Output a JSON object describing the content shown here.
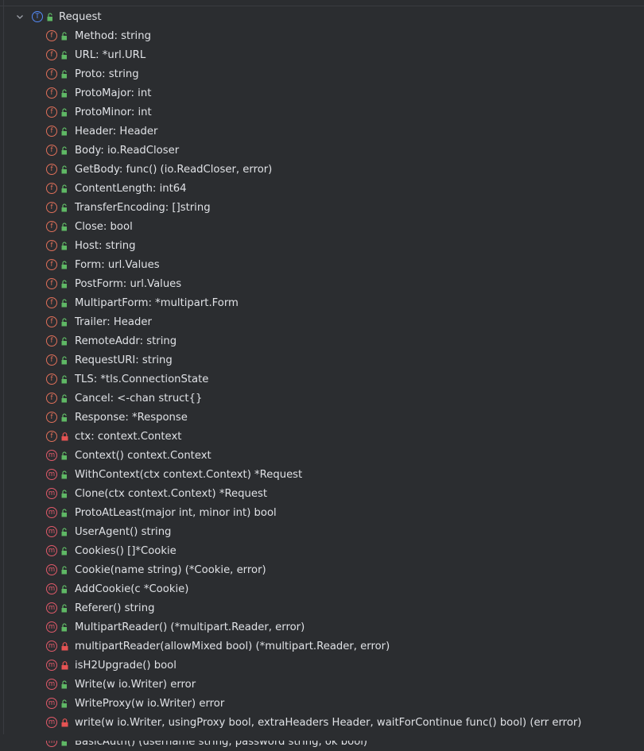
{
  "tree": {
    "root": {
      "label": "Request",
      "kind_letter": "T",
      "expanded": true,
      "visibility": "public"
    },
    "items": [
      {
        "kind": "f",
        "vis": "public",
        "label": "Method: string"
      },
      {
        "kind": "f",
        "vis": "public",
        "label": "URL: *url.URL"
      },
      {
        "kind": "f",
        "vis": "public",
        "label": "Proto: string"
      },
      {
        "kind": "f",
        "vis": "public",
        "label": "ProtoMajor: int"
      },
      {
        "kind": "f",
        "vis": "public",
        "label": "ProtoMinor: int"
      },
      {
        "kind": "f",
        "vis": "public",
        "label": "Header: Header"
      },
      {
        "kind": "f",
        "vis": "public",
        "label": "Body: io.ReadCloser"
      },
      {
        "kind": "f",
        "vis": "public",
        "label": "GetBody: func() (io.ReadCloser, error)"
      },
      {
        "kind": "f",
        "vis": "public",
        "label": "ContentLength: int64"
      },
      {
        "kind": "f",
        "vis": "public",
        "label": "TransferEncoding: []string"
      },
      {
        "kind": "f",
        "vis": "public",
        "label": "Close: bool"
      },
      {
        "kind": "f",
        "vis": "public",
        "label": "Host: string"
      },
      {
        "kind": "f",
        "vis": "public",
        "label": "Form: url.Values"
      },
      {
        "kind": "f",
        "vis": "public",
        "label": "PostForm: url.Values"
      },
      {
        "kind": "f",
        "vis": "public",
        "label": "MultipartForm: *multipart.Form"
      },
      {
        "kind": "f",
        "vis": "public",
        "label": "Trailer: Header"
      },
      {
        "kind": "f",
        "vis": "public",
        "label": "RemoteAddr: string"
      },
      {
        "kind": "f",
        "vis": "public",
        "label": "RequestURI: string"
      },
      {
        "kind": "f",
        "vis": "public",
        "label": "TLS: *tls.ConnectionState"
      },
      {
        "kind": "f",
        "vis": "public",
        "label": "Cancel: <-chan struct{}"
      },
      {
        "kind": "f",
        "vis": "public",
        "label": "Response: *Response"
      },
      {
        "kind": "f",
        "vis": "private",
        "label": "ctx: context.Context"
      },
      {
        "kind": "m",
        "vis": "public",
        "label": "Context() context.Context"
      },
      {
        "kind": "m",
        "vis": "public",
        "label": "WithContext(ctx context.Context) *Request"
      },
      {
        "kind": "m",
        "vis": "public",
        "label": "Clone(ctx context.Context) *Request"
      },
      {
        "kind": "m",
        "vis": "public",
        "label": "ProtoAtLeast(major int, minor int) bool"
      },
      {
        "kind": "m",
        "vis": "public",
        "label": "UserAgent() string"
      },
      {
        "kind": "m",
        "vis": "public",
        "label": "Cookies() []*Cookie"
      },
      {
        "kind": "m",
        "vis": "public",
        "label": "Cookie(name string) (*Cookie, error)"
      },
      {
        "kind": "m",
        "vis": "public",
        "label": "AddCookie(c *Cookie)"
      },
      {
        "kind": "m",
        "vis": "public",
        "label": "Referer() string"
      },
      {
        "kind": "m",
        "vis": "public",
        "label": "MultipartReader() (*multipart.Reader, error)"
      },
      {
        "kind": "m",
        "vis": "private",
        "label": "multipartReader(allowMixed bool) (*multipart.Reader, error)"
      },
      {
        "kind": "m",
        "vis": "private",
        "label": "isH2Upgrade() bool"
      },
      {
        "kind": "m",
        "vis": "public",
        "label": "Write(w io.Writer) error"
      },
      {
        "kind": "m",
        "vis": "public",
        "label": "WriteProxy(w io.Writer) error"
      },
      {
        "kind": "m",
        "vis": "private",
        "label": "write(w io.Writer, usingProxy bool, extraHeaders Header, waitForContinue func() bool) (err error)"
      },
      {
        "kind": "m",
        "vis": "public",
        "label": "BasicAuth() (username string, password string, ok bool)"
      }
    ]
  },
  "colors": {
    "background": "#2b2d30",
    "text": "#dfe1e5",
    "field_icon": "#e0705a",
    "method_icon": "#e25a6a",
    "type_icon": "#548af7",
    "public_lock": "#5fb865",
    "private_lock": "#e55353"
  },
  "icons": {
    "expand": "chevron-down-icon",
    "field": "field-icon",
    "method": "method-icon",
    "type": "type-icon",
    "public": "unlocked-icon",
    "private": "locked-icon"
  }
}
